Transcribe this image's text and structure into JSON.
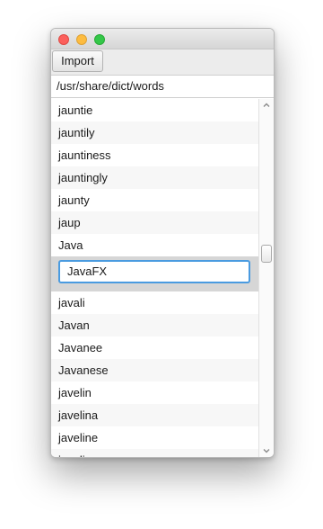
{
  "window": {
    "traffic_lights": [
      "close",
      "minimize",
      "maximize"
    ]
  },
  "toolbar": {
    "import_label": "Import"
  },
  "path_field": {
    "value": "/usr/share/dict/words"
  },
  "list": {
    "items_before": [
      "jauntie",
      "jauntily",
      "jauntiness",
      "jauntingly",
      "jaunty",
      "jaup",
      "Java"
    ],
    "editing_value": "JavaFX",
    "items_after": [
      "javali",
      "Javan",
      "Javanee",
      "Javanese",
      "javelin",
      "javelina",
      "javeline",
      "javelineer"
    ]
  },
  "scrollbar": {
    "position_fraction": 0.43
  },
  "icons": {
    "up": "chevron-up-icon",
    "down": "chevron-down-icon"
  }
}
